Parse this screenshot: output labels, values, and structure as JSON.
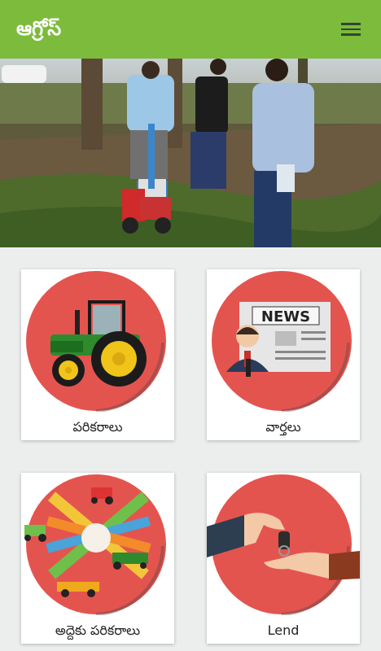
{
  "appbar": {
    "title": "ఆగ్రోస్",
    "color": "#7dbb3c",
    "menu_icon": "hamburger-menu-icon"
  },
  "carousel": {
    "slide_count": 1,
    "active_index": 0,
    "indicator_color": "#1a6fd6"
  },
  "tiles": [
    {
      "label": "పరికరాలు",
      "icon": "tractor-icon"
    },
    {
      "label": "వార్తలు",
      "icon": "news-icon"
    },
    {
      "label": "అద్దెకు పరికరాలు",
      "icon": "rental-equipment-icon"
    },
    {
      "label": "Lend",
      "icon": "key-handover-icon"
    }
  ],
  "news_icon_text": "NEWS",
  "colors": {
    "tile_circle": "#e4544f",
    "background": "#eceeee"
  }
}
